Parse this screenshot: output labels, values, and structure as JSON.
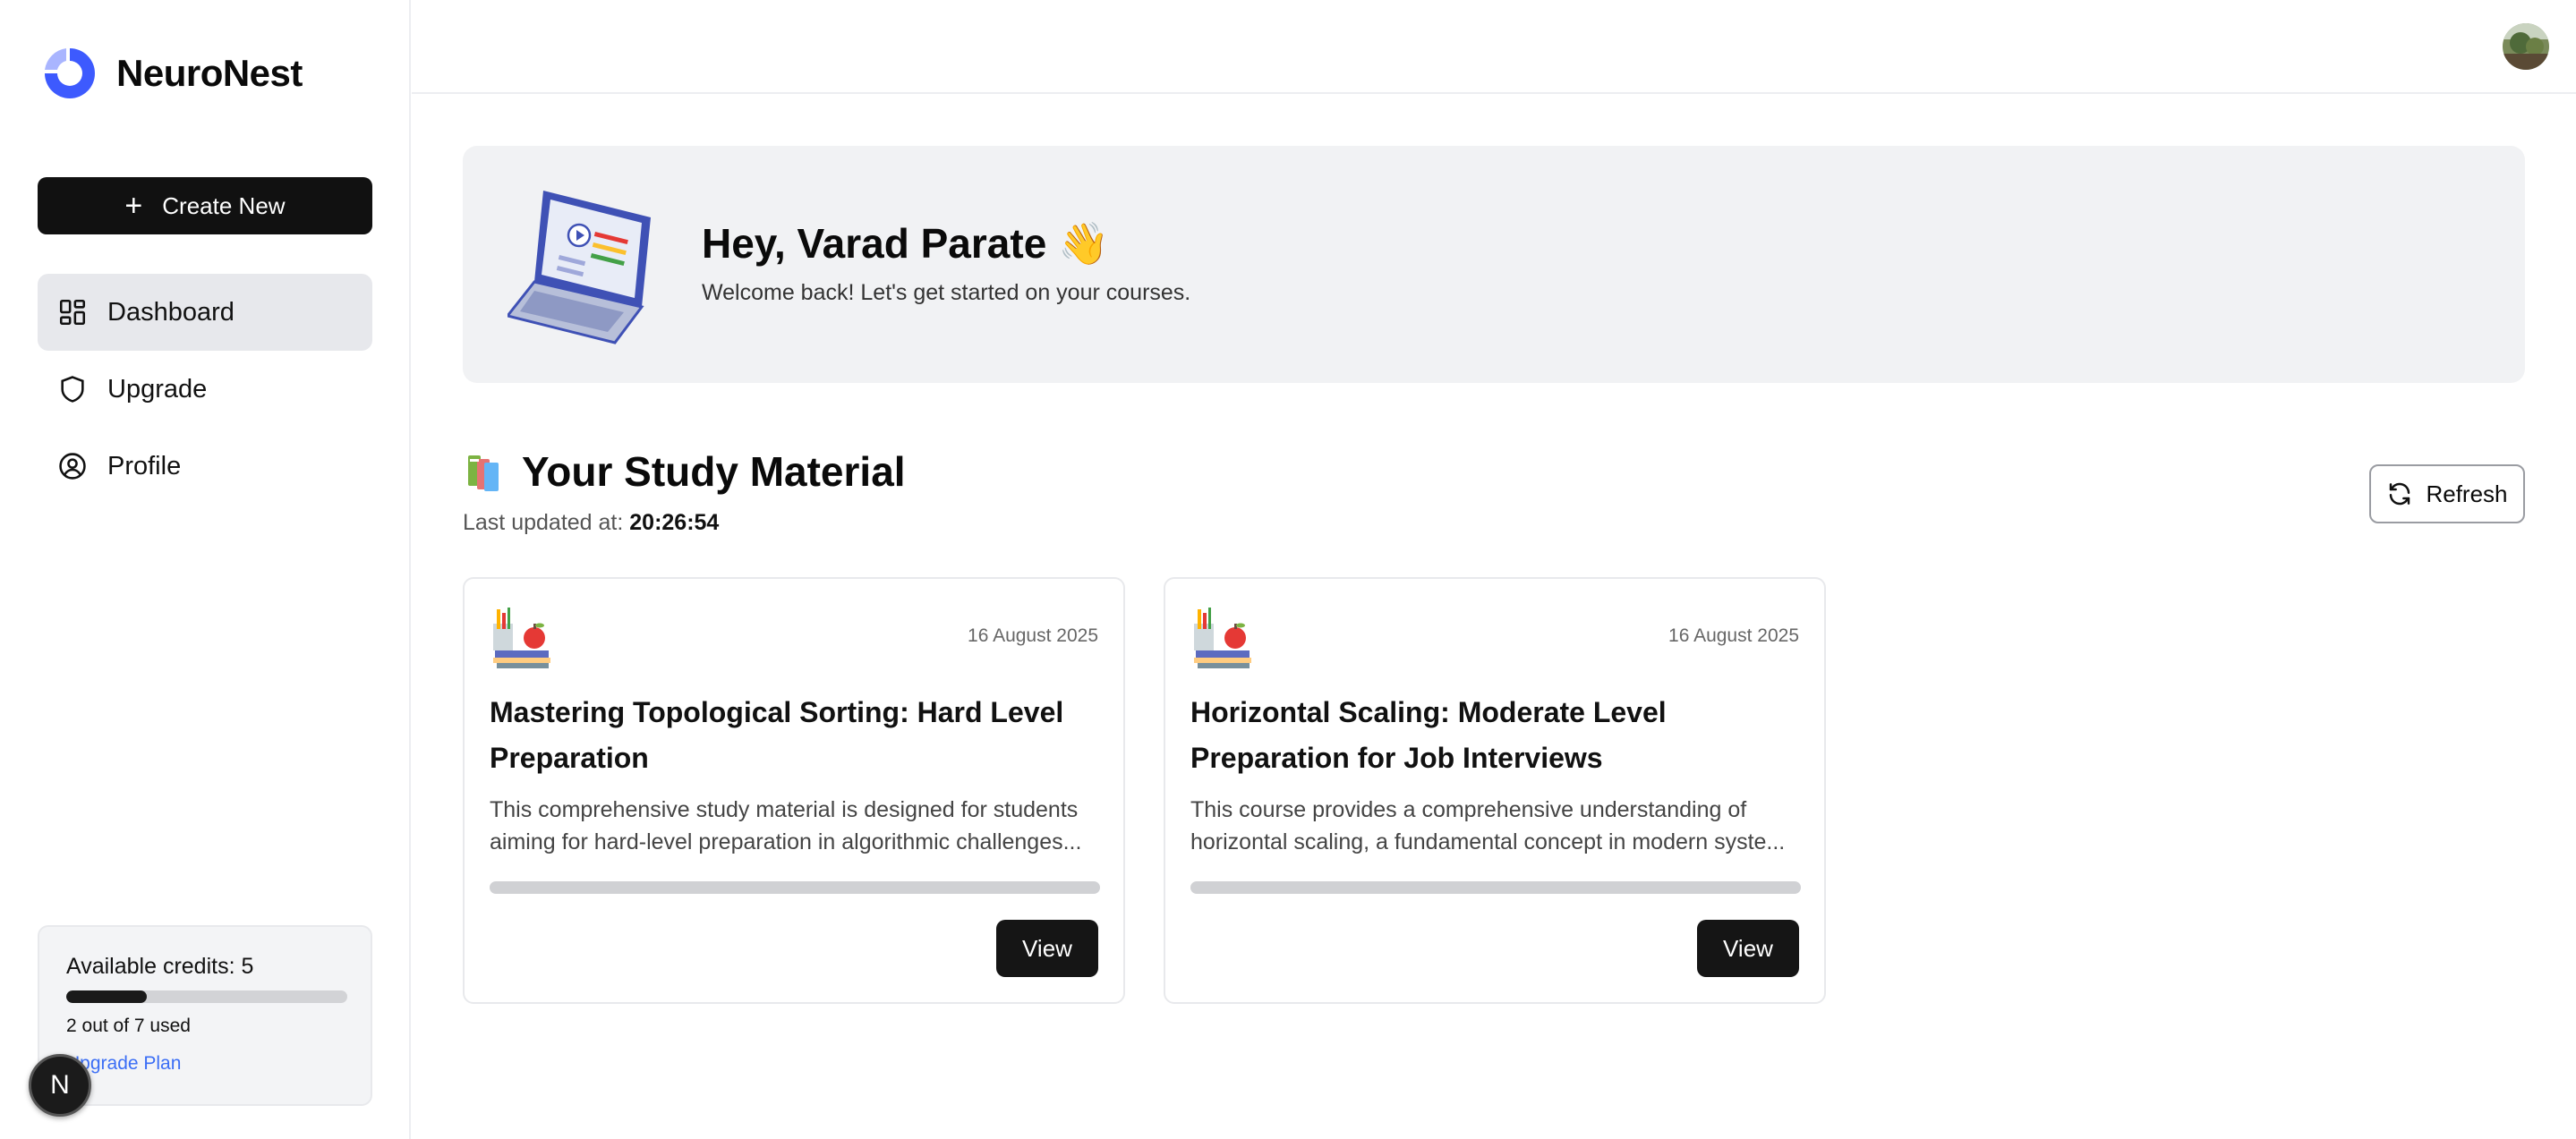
{
  "brand": {
    "name": "NeuroNest",
    "accent": "#3d5afe"
  },
  "sidebar": {
    "create_label": "Create New",
    "items": [
      {
        "label": "Dashboard",
        "icon": "dashboard-icon",
        "active": true
      },
      {
        "label": "Upgrade",
        "icon": "shield-icon",
        "active": false
      },
      {
        "label": "Profile",
        "icon": "user-circle-icon",
        "active": false
      }
    ],
    "credits": {
      "title": "Available credits: 5",
      "used_text": "2 out of 7 used",
      "used": 2,
      "total": 7,
      "upgrade_label": "Upgrade Plan"
    },
    "floating_avatar_letter": "N"
  },
  "banner": {
    "greeting": "Hey, Varad Parate 👋",
    "subtitle": "Welcome back! Let's get started on your courses."
  },
  "study": {
    "title": "Your Study Material",
    "updated_label": "Last updated at:",
    "updated_time": "20:26:54",
    "refresh_label": "Refresh",
    "cards": [
      {
        "date": "16 August 2025",
        "title": "Mastering Topological Sorting: Hard Level Preparation",
        "description": "This comprehensive study material is designed for students aiming for hard-level preparation in algorithmic challenges...",
        "progress": 0,
        "view_label": "View"
      },
      {
        "date": "16 August 2025",
        "title": "Horizontal Scaling: Moderate Level Preparation for Job Interviews",
        "description": "This course provides a comprehensive understanding of horizontal scaling, a fundamental concept in modern syste...",
        "progress": 0,
        "view_label": "View"
      }
    ]
  }
}
